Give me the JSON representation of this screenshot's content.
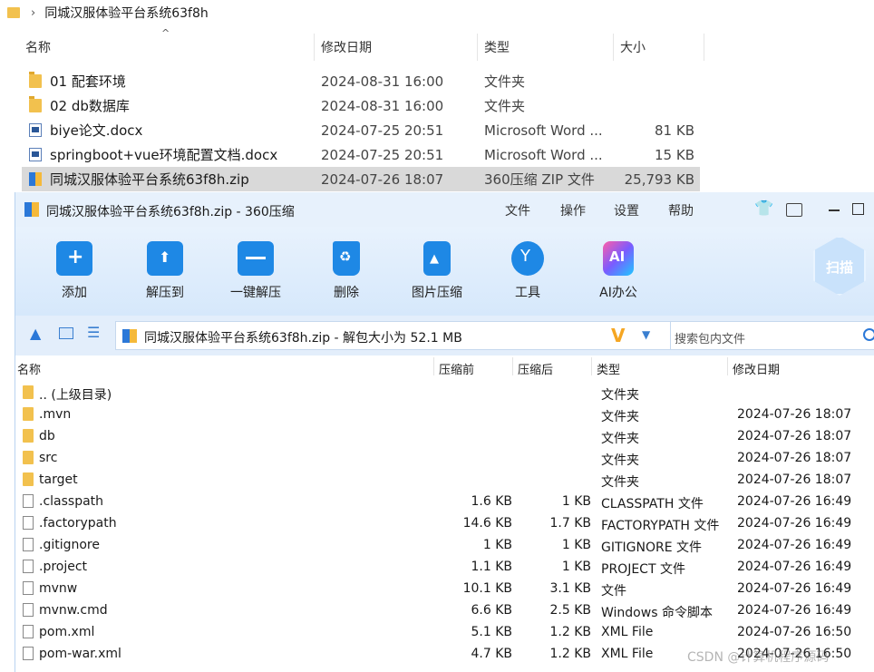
{
  "explorer": {
    "breadcrumb": "同城汉服体验平台系统63f8h",
    "columns": {
      "name": "名称",
      "date": "修改日期",
      "type": "类型",
      "size": "大小"
    },
    "rows": [
      {
        "icon": "folder-icon",
        "name": "01 配套环境",
        "date": "2024-08-31 16:00",
        "type": "文件夹",
        "size": ""
      },
      {
        "icon": "folder-icon",
        "name": "02 db数据库",
        "date": "2024-08-31 16:00",
        "type": "文件夹",
        "size": ""
      },
      {
        "icon": "word-doc-icon",
        "name": "biye论文.docx",
        "date": "2024-07-25 20:51",
        "type": "Microsoft Word ...",
        "size": "81 KB"
      },
      {
        "icon": "word-doc-icon",
        "name": "springboot+vue环境配置文档.docx",
        "date": "2024-07-25 20:51",
        "type": "Microsoft Word ...",
        "size": "15 KB"
      },
      {
        "icon": "zip-icon",
        "name": "同城汉服体验平台系统63f8h.zip",
        "date": "2024-07-26 18:07",
        "type": "360压缩 ZIP 文件",
        "size": "25,793 KB"
      }
    ]
  },
  "zipwin": {
    "title": "同城汉服体验平台系统63f8h.zip - 360压缩",
    "menu": [
      "文件",
      "操作",
      "设置",
      "帮助"
    ],
    "toolbar": [
      "添加",
      "解压到",
      "一键解压",
      "删除",
      "图片压缩",
      "工具",
      "AI办公"
    ],
    "scan_label": "扫描",
    "ai_icon_text": "AI",
    "address": "同城汉服体验平台系统63f8h.zip - 解包大小为 52.1 MB",
    "search_placeholder": "搜索包内文件",
    "columns": {
      "name": "名称",
      "packed": "压缩前",
      "compressed": "压缩后",
      "type": "类型",
      "date": "修改日期"
    },
    "rows": [
      {
        "kind": "folder",
        "name": ".. (上级目录)",
        "packed": "",
        "compressed": "",
        "type": "文件夹",
        "date": ""
      },
      {
        "kind": "folder",
        "name": ".mvn",
        "packed": "",
        "compressed": "",
        "type": "文件夹",
        "date": "2024-07-26 18:07"
      },
      {
        "kind": "folder",
        "name": "db",
        "packed": "",
        "compressed": "",
        "type": "文件夹",
        "date": "2024-07-26 18:07"
      },
      {
        "kind": "folder",
        "name": "src",
        "packed": "",
        "compressed": "",
        "type": "文件夹",
        "date": "2024-07-26 18:07"
      },
      {
        "kind": "folder",
        "name": "target",
        "packed": "",
        "compressed": "",
        "type": "文件夹",
        "date": "2024-07-26 18:07"
      },
      {
        "kind": "file",
        "name": ".classpath",
        "packed": "1.6 KB",
        "compressed": "1 KB",
        "type": "CLASSPATH 文件",
        "date": "2024-07-26 16:49"
      },
      {
        "kind": "file",
        "name": ".factorypath",
        "packed": "14.6 KB",
        "compressed": "1.7 KB",
        "type": "FACTORYPATH 文件",
        "date": "2024-07-26 16:49"
      },
      {
        "kind": "file",
        "name": ".gitignore",
        "packed": "1 KB",
        "compressed": "1 KB",
        "type": "GITIGNORE 文件",
        "date": "2024-07-26 16:49"
      },
      {
        "kind": "file",
        "name": ".project",
        "packed": "1.1 KB",
        "compressed": "1 KB",
        "type": "PROJECT 文件",
        "date": "2024-07-26 16:49"
      },
      {
        "kind": "file",
        "name": "mvnw",
        "packed": "10.1 KB",
        "compressed": "3.1 KB",
        "type": "文件",
        "date": "2024-07-26 16:49"
      },
      {
        "kind": "file",
        "name": "mvnw.cmd",
        "packed": "6.6 KB",
        "compressed": "2.5 KB",
        "type": "Windows 命令脚本",
        "date": "2024-07-26 16:49"
      },
      {
        "kind": "file",
        "name": "pom.xml",
        "packed": "5.1 KB",
        "compressed": "1.2 KB",
        "type": "XML File",
        "date": "2024-07-26 16:50"
      },
      {
        "kind": "file",
        "name": "pom-war.xml",
        "packed": "4.7 KB",
        "compressed": "1.2 KB",
        "type": "XML File",
        "date": "2024-07-26 16:50"
      }
    ]
  },
  "watermark": "CSDN @计算机程序源码"
}
